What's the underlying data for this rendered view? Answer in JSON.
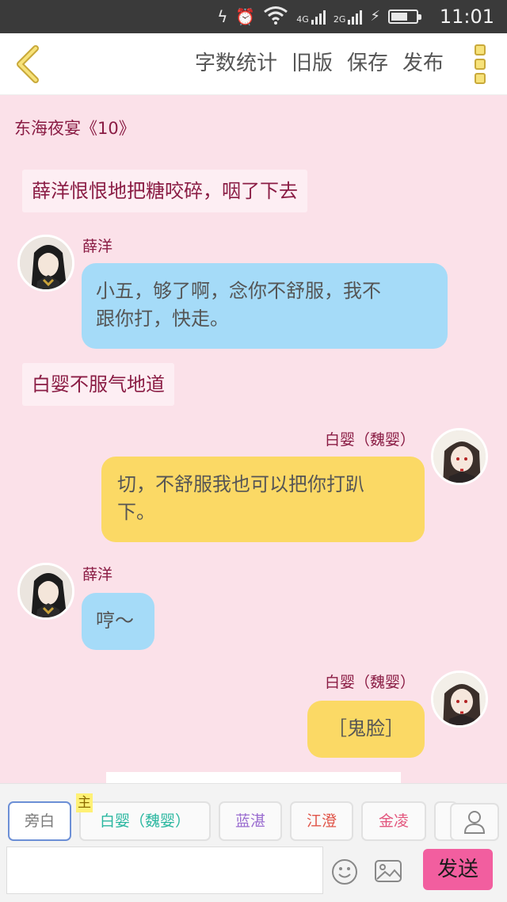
{
  "status_bar": {
    "time": "11:01",
    "network_4g": "4G",
    "network_2g": "2G"
  },
  "toolbar": {
    "word_count": "字数统计",
    "old_version": "旧版",
    "save": "保存",
    "publish": "发布"
  },
  "chat": {
    "chapter_title": "东海夜宴《10》",
    "messages": [
      {
        "type": "narration",
        "text": "薛洋恨恨地把糖咬碎，咽了下去"
      },
      {
        "type": "left",
        "name": "薛洋",
        "text_lines": [
          "小五，够了啊，念你不舒服，我不",
          "跟你打，快走。"
        ]
      },
      {
        "type": "narration",
        "text": "白婴不服气地道"
      },
      {
        "type": "right",
        "name": "白婴（魏婴）",
        "text_lines": [
          "切，不舒服我也可以把你打趴",
          "下。"
        ]
      },
      {
        "type": "left",
        "name": "薛洋",
        "text_lines": [
          "哼～"
        ]
      },
      {
        "type": "right",
        "name": "白婴（魏婴）",
        "text_lines": [
          "［鬼脸］"
        ]
      }
    ]
  },
  "characters": {
    "main_tag": "主",
    "chips": [
      {
        "label": "旁白",
        "color": "#7a7a7a"
      },
      {
        "label": "白婴（魏婴）",
        "color": "#2ab7a0"
      },
      {
        "label": "蓝湛",
        "color": "#9a6cd0"
      },
      {
        "label": "江澄",
        "color": "#e0564a"
      },
      {
        "label": "金凌",
        "color": "#e3577e"
      }
    ]
  },
  "composer": {
    "input_value": "",
    "send_label": "发送"
  },
  "colors": {
    "background": "#fbe1e9",
    "blue_bubble": "#a5dbf8",
    "yellow_bubble": "#fbd965",
    "name_color": "#8a1c44",
    "send_button": "#f25e9f"
  }
}
